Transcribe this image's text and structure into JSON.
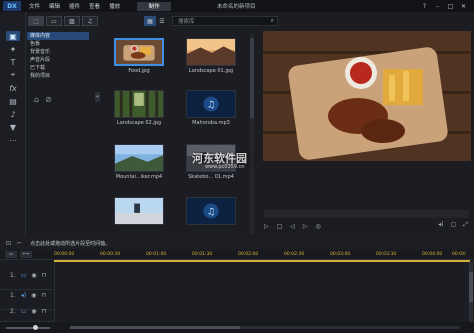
{
  "app": {
    "logo_text": "DX",
    "menu": [
      "文件",
      "编辑",
      "插件",
      "查看",
      "播放"
    ],
    "produce_label": "制作",
    "project_title": "未命名的新项目",
    "window_controls": [
      "?",
      "–",
      "□",
      "✕"
    ]
  },
  "library": {
    "search_placeholder": "搜索库",
    "categories": [
      "媒体内容",
      "色板",
      "背景音乐",
      "声音片段",
      "已下载",
      "我的项目"
    ],
    "media": [
      {
        "name": "Food.jpg",
        "selected": true
      },
      {
        "name": "Landscape 01.jpg",
        "selected": false
      },
      {
        "name": "Landscape 02.jpg",
        "selected": false
      },
      {
        "name": "Mahoroba.mp3",
        "selected": false
      },
      {
        "name": "Mountai...iker.mp4",
        "selected": false
      },
      {
        "name": "Skatebo... 01.mp4",
        "selected": false
      },
      {
        "name": "",
        "selected": false
      },
      {
        "name": "",
        "selected": false
      }
    ]
  },
  "watermark": {
    "text": "河东软件园",
    "url": "www.pc0359.cn"
  },
  "timeline": {
    "hint": "点击此处或拖动所选片段至时间轴。",
    "track_modes": [
      "▭",
      "⟷"
    ],
    "ticks": [
      "00:00:00",
      "00:00:30",
      "00:01:00",
      "00:01:30",
      "00:02:00",
      "00:02:30",
      "00:03:00",
      "00:03:30",
      "00:04:00",
      "00:04:"
    ],
    "tracks": [
      {
        "label": "1."
      },
      {
        "label": "1."
      },
      {
        "label": "2."
      }
    ]
  }
}
